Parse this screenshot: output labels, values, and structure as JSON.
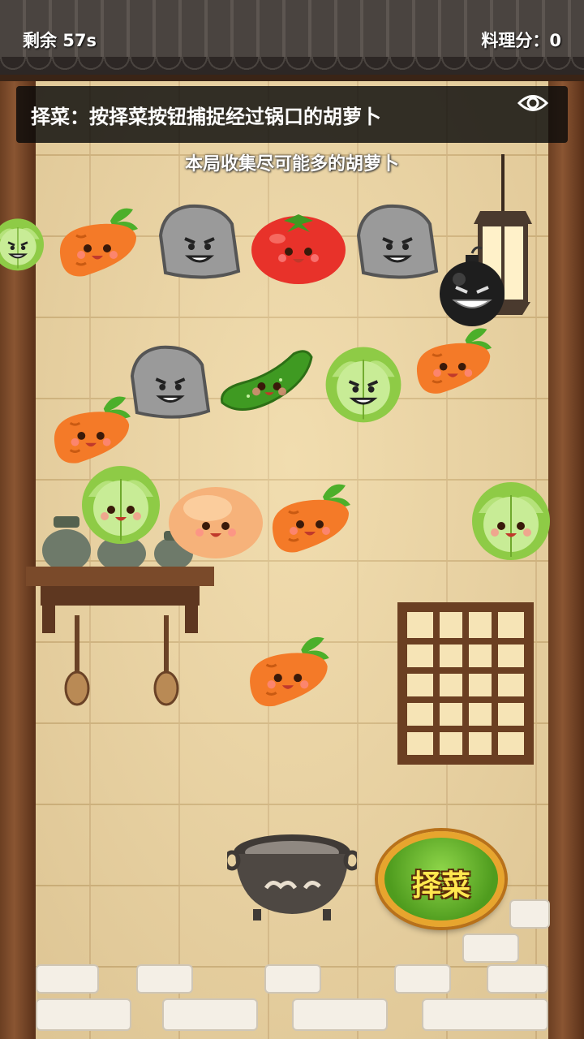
{
  "hud": {
    "timer_label": "剩余 57s",
    "score_label": "料理分：0"
  },
  "hint": {
    "text": "择菜：按择菜按钮捕捉经过锅口的胡萝卜",
    "toggle_icon": "eye-icon"
  },
  "goal": "本局收集尽可能多的胡萝卜",
  "items": [
    {
      "kind": "cabbage",
      "mood": "angry",
      "row": 1
    },
    {
      "kind": "carrot",
      "mood": "happy",
      "row": 1
    },
    {
      "kind": "rock",
      "mood": "angry",
      "row": 1
    },
    {
      "kind": "tomato",
      "mood": "happy",
      "row": 1
    },
    {
      "kind": "rock",
      "mood": "angry",
      "row": 1
    },
    {
      "kind": "bomb",
      "mood": "angry",
      "row": 1
    },
    {
      "kind": "rock",
      "mood": "angry",
      "row": 2
    },
    {
      "kind": "cucumber",
      "mood": "happy",
      "row": 2
    },
    {
      "kind": "cabbage",
      "mood": "angry",
      "row": 2
    },
    {
      "kind": "carrot",
      "mood": "happy",
      "row": 2
    },
    {
      "kind": "carrot",
      "mood": "happy",
      "row": 3
    },
    {
      "kind": "cabbage",
      "mood": "happy",
      "row": 3
    },
    {
      "kind": "dumpling",
      "mood": "happy",
      "row": 3
    },
    {
      "kind": "carrot",
      "mood": "happy",
      "row": 3
    },
    {
      "kind": "cabbage",
      "mood": "happy",
      "row": 3
    },
    {
      "kind": "carrot",
      "mood": "happy",
      "row": 4
    }
  ],
  "pick_button": {
    "label": "择菜"
  },
  "colors": {
    "hint_bg": "#0a0a0a",
    "button_green": "#5aa82a",
    "button_rim": "#e7a52e",
    "button_text": "#ffe84f"
  }
}
